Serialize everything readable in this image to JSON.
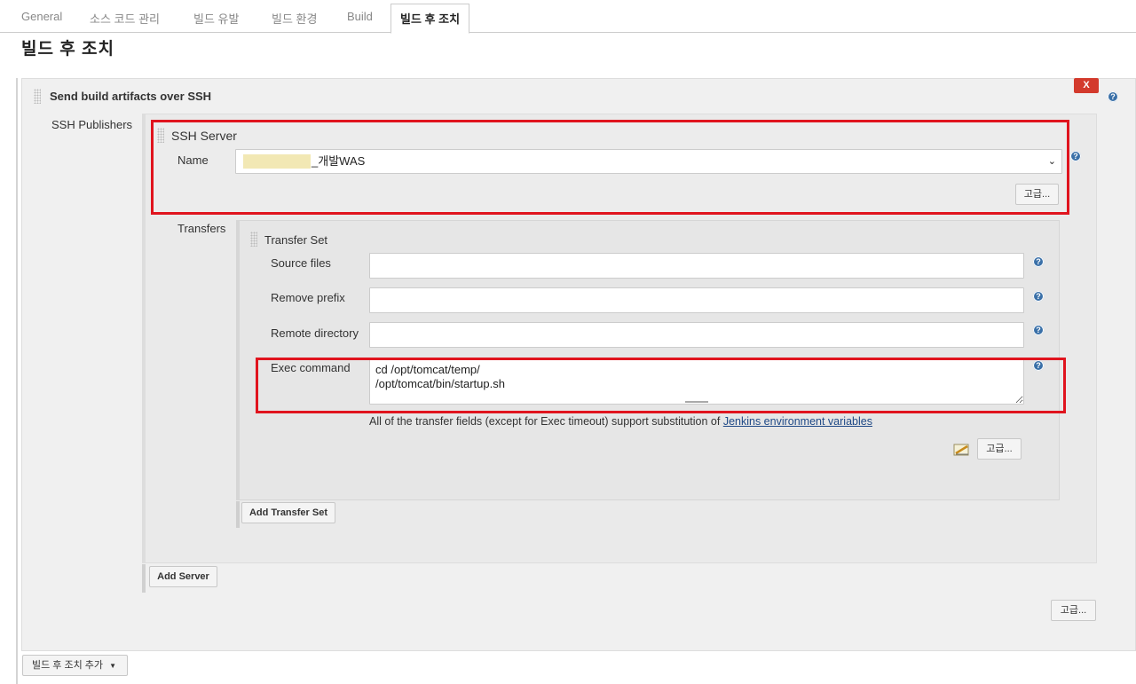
{
  "tabs": [
    {
      "label": "General"
    },
    {
      "label": "소스 코드 관리"
    },
    {
      "label": "빌드 유발"
    },
    {
      "label": "빌드 환경"
    },
    {
      "label": "Build"
    },
    {
      "label": "빌드 후 조치"
    }
  ],
  "section_title": "빌드 후 조치",
  "publisher": {
    "title": "Send build artifacts over SSH",
    "delete_label": "X",
    "ssh_publishers_label": "SSH Publishers",
    "ssh_server": {
      "title": "SSH Server",
      "name_label": "Name",
      "name_value": "_개발WAS",
      "advanced_label": "고급..."
    },
    "transfers_label": "Transfers",
    "transfer_set": {
      "title": "Transfer Set",
      "source_files_label": "Source files",
      "source_files_value": "",
      "remove_prefix_label": "Remove prefix",
      "remove_prefix_value": "",
      "remote_directory_label": "Remote directory",
      "remote_directory_value": "",
      "exec_command_label": "Exec command",
      "exec_command_value": "cd /opt/tomcat/temp/\n/opt/tomcat/bin/startup.sh",
      "note_prefix": "All of the transfer fields (except for Exec timeout) support substitution of ",
      "note_link": "Jenkins environment variables",
      "advanced_label": "고급..."
    },
    "add_transfer_set_label": "Add Transfer Set",
    "add_server_label": "Add Server",
    "advanced_label": "고급..."
  },
  "add_post_build_label": "빌드 후 조치 추가",
  "help_glyph": "?",
  "colors": {
    "highlight": "#e0141e",
    "delete": "#d33a2c",
    "help": "#3a70a8"
  }
}
